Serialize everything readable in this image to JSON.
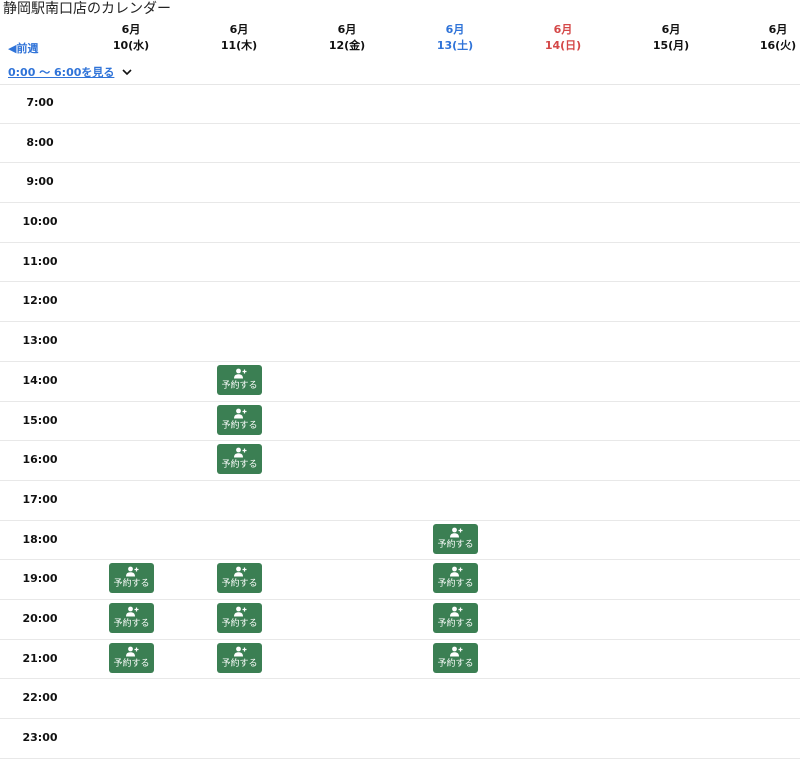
{
  "title": "静岡駅南口店のカレンダー",
  "nav": {
    "prev_week": "◀前週"
  },
  "days": [
    {
      "month": "6月",
      "date": "10(水)",
      "kind": "weekday"
    },
    {
      "month": "6月",
      "date": "11(木)",
      "kind": "weekday"
    },
    {
      "month": "6月",
      "date": "12(金)",
      "kind": "weekday"
    },
    {
      "month": "6月",
      "date": "13(土)",
      "kind": "sat"
    },
    {
      "month": "6月",
      "date": "14(日)",
      "kind": "sun"
    },
    {
      "month": "6月",
      "date": "15(月)",
      "kind": "weekday"
    },
    {
      "month": "6月",
      "date": "16(火)",
      "kind": "weekday"
    }
  ],
  "early_toggle": "0:00 〜 6:00を見る",
  "times": [
    "7:00",
    "8:00",
    "9:00",
    "10:00",
    "11:00",
    "12:00",
    "13:00",
    "14:00",
    "15:00",
    "16:00",
    "17:00",
    "18:00",
    "19:00",
    "20:00",
    "21:00",
    "22:00",
    "23:00"
  ],
  "reserve_label": "予約する",
  "slots": [
    {
      "time": "14:00",
      "day": 1
    },
    {
      "time": "15:00",
      "day": 1
    },
    {
      "time": "16:00",
      "day": 1
    },
    {
      "time": "18:00",
      "day": 3
    },
    {
      "time": "19:00",
      "day": 0
    },
    {
      "time": "19:00",
      "day": 1
    },
    {
      "time": "19:00",
      "day": 3
    },
    {
      "time": "20:00",
      "day": 0
    },
    {
      "time": "20:00",
      "day": 1
    },
    {
      "time": "20:00",
      "day": 3
    },
    {
      "time": "21:00",
      "day": 0
    },
    {
      "time": "21:00",
      "day": 1
    },
    {
      "time": "21:00",
      "day": 3
    }
  ],
  "colors": {
    "link": "#2f73d8",
    "saturday": "#2f73d8",
    "sunday": "#d44848",
    "reserve_button": "#3b7f53"
  },
  "icons": {
    "prev": "triangle-left-icon",
    "toggle": "chevron-down-icon",
    "reserve": "person-add-icon"
  }
}
